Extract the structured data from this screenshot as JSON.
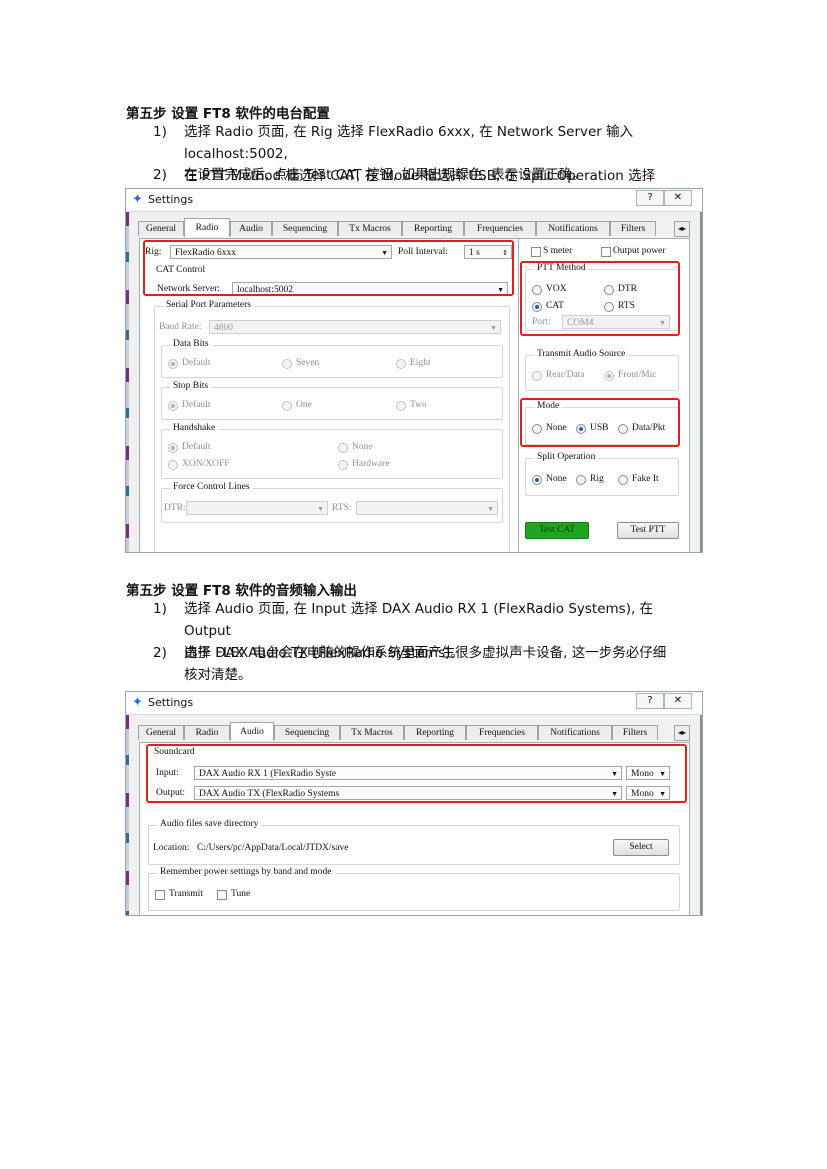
{
  "doc": {
    "section1": {
      "heading": "第五步 设置 FT8 软件的电台配置",
      "items": [
        {
          "num": "1)",
          "line1": "选择 Radio 页面, 在 Rig 选择 FlexRadio 6xxx, 在 Network Server 输入 localhost:5002,",
          "line2": "在 PTT Method 框选择 CAT, 在 Mode 框选择 USB, 在 Split Operation 选择 None。"
        },
        {
          "num": "2)",
          "line1": "在设置完成后, 点击 Test CAT 按钮, 如果出现绿色, 表示设置正确。"
        }
      ]
    },
    "section2": {
      "heading": "第五步 设置 FT8 软件的音频输入输出",
      "items": [
        {
          "num": "1)",
          "line1": "选择 Audio 页面, 在 Input 选择 DAX Audio RX 1 (FlexRadio Systems), 在 Output",
          "line2": "选择 DAX Audio TX (FlexRadio Systems)。"
        },
        {
          "num": "2)",
          "line1": "由于 FLEX 电台会在电脑的操作系统里面产生很多虚拟声卡设备, 这一步务必仔细",
          "line2": "核对清楚。"
        }
      ]
    }
  },
  "window": {
    "title": "Settings",
    "help_btn": "?",
    "close_btn": "✕",
    "tabs": [
      "General",
      "Radio",
      "Audio",
      "Sequencing",
      "Tx Macros",
      "Reporting",
      "Frequencies",
      "Notifications",
      "Filters"
    ],
    "tab_scroll": "◂▸"
  },
  "radio": {
    "rig_label": "Rig:",
    "rig_value": "FlexRadio 6xxx",
    "poll_label": "Poll Interval:",
    "poll_value": "1 s",
    "s_meter": "S meter",
    "output_power": "Output power",
    "cat_control": "CAT Control",
    "network_server_label": "Network Server:",
    "network_server_value": "localhost:5002",
    "serial_port_params": "Serial Port Parameters",
    "baud_rate_label": "Baud Rate:",
    "baud_rate_value": "4800",
    "data_bits": {
      "title": "Data Bits",
      "options": [
        "Default",
        "Seven",
        "Eight"
      ],
      "selected": "Default"
    },
    "stop_bits": {
      "title": "Stop Bits",
      "options": [
        "Default",
        "One",
        "Two"
      ],
      "selected": "Default"
    },
    "handshake": {
      "title": "Handshake",
      "options": [
        "Default",
        "None",
        "XON/XOFF",
        "Hardware"
      ],
      "selected": "Default"
    },
    "force_control": {
      "title": "Force Control Lines",
      "dtr_label": "DTR:",
      "rts_label": "RTS:"
    },
    "ptt_method": {
      "title": "PTT Method",
      "options": [
        "VOX",
        "DTR",
        "CAT",
        "RTS"
      ],
      "selected": "CAT",
      "port_label": "Port:",
      "port_value": "COM4"
    },
    "tx_audio_source": {
      "title": "Transmit Audio Source",
      "options": [
        "Rear/Data",
        "Front/Mic"
      ],
      "selected": "Front/Mic"
    },
    "mode": {
      "title": "Mode",
      "options": [
        "None",
        "USB",
        "Data/Pkt"
      ],
      "selected": "USB"
    },
    "split": {
      "title": "Split Operation",
      "options": [
        "None",
        "Rig",
        "Fake It"
      ],
      "selected": "None"
    },
    "test_cat": "Test CAT",
    "test_ptt": "Test PTT"
  },
  "audio": {
    "soundcard": "Soundcard",
    "input_label": "Input:",
    "input_value": "DAX Audio RX 1 (FlexRadio Syste",
    "input_channel": "Mono",
    "output_label": "Output:",
    "output_value": "DAX Audio TX (FlexRadio Systems",
    "output_channel": "Mono",
    "save_dir_title": "Audio files save directory",
    "location_label": "Location:",
    "location_value": "C:/Users/pc/AppData/Local/JTDX/save",
    "select_btn": "Select",
    "remember_title": "Remember power settings by band and mode",
    "transmit": "Transmit",
    "tune": "Tune"
  },
  "colors": {
    "highlight": "#e02020",
    "test_cat_green": "#1fa51f",
    "window_bg": "#f0f0f0"
  }
}
